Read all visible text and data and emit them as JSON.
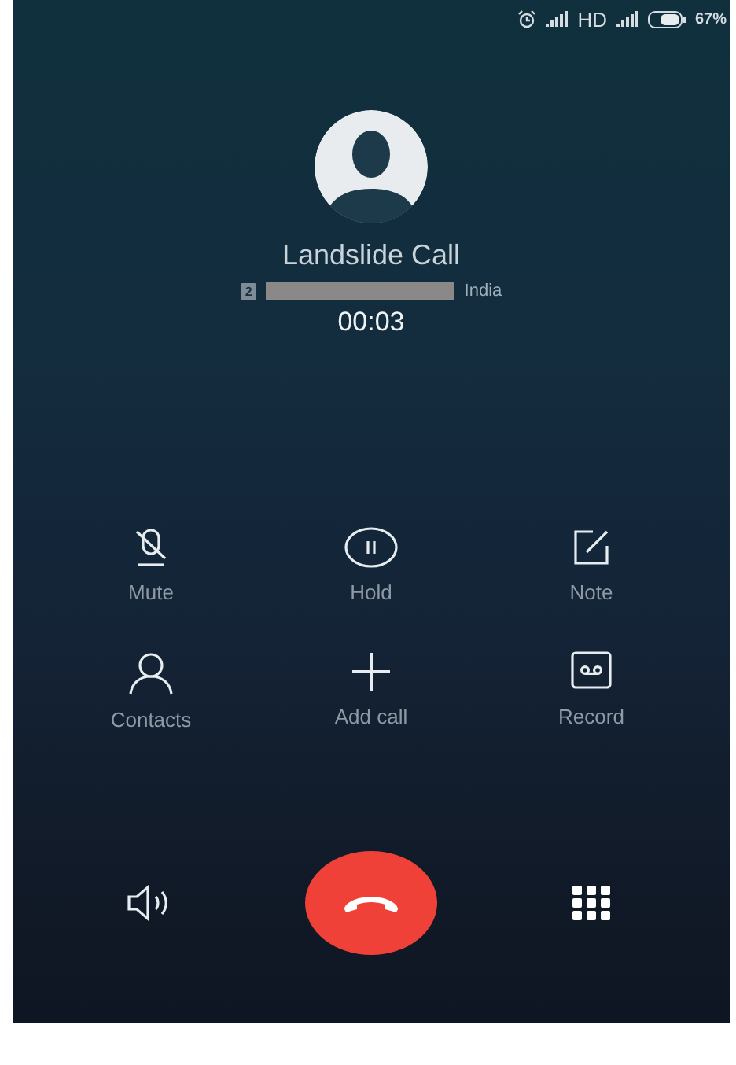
{
  "status_bar": {
    "network": "HD",
    "battery": "67%"
  },
  "caller": {
    "name": "Landslide Call",
    "sim": "2",
    "country": "India",
    "duration": "00:03"
  },
  "actions": [
    {
      "kind": "mute",
      "label": "Mute"
    },
    {
      "kind": "hold",
      "label": "Hold"
    },
    {
      "kind": "note",
      "label": "Note"
    },
    {
      "kind": "contacts",
      "label": "Contacts"
    },
    {
      "kind": "add",
      "label": "Add call"
    },
    {
      "kind": "record",
      "label": "Record"
    }
  ],
  "bottom": [
    {
      "kind": "speaker"
    },
    {
      "kind": "end"
    },
    {
      "kind": "keypad"
    }
  ]
}
